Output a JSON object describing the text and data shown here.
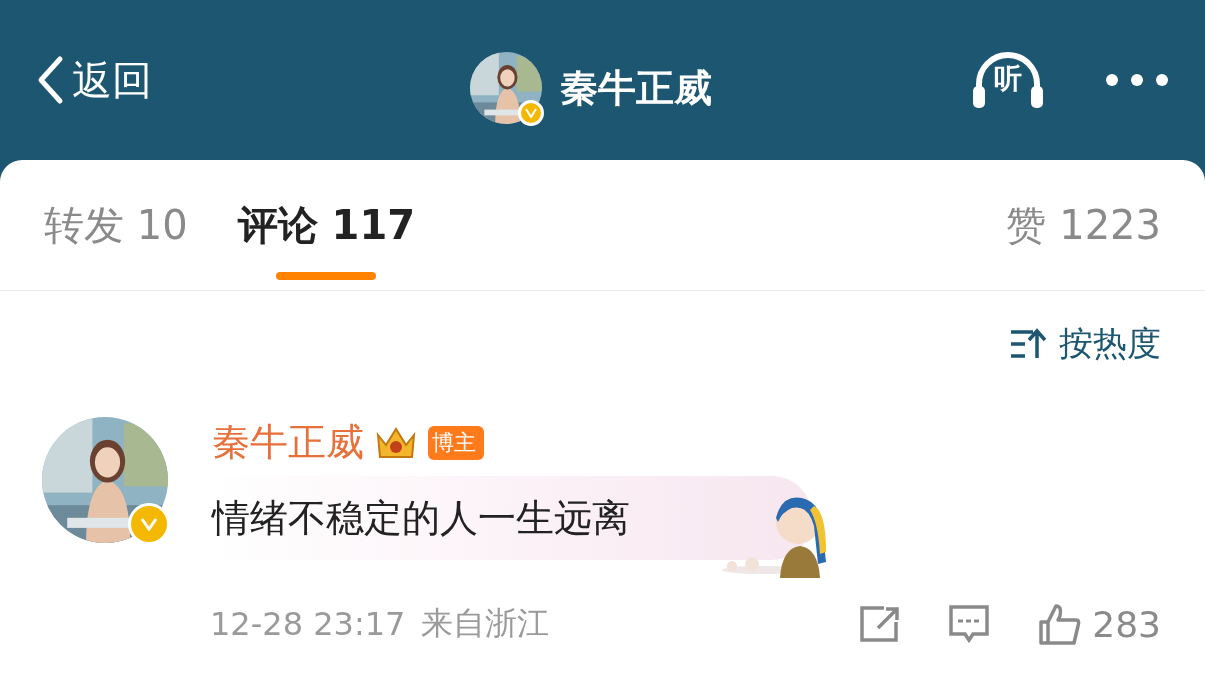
{
  "header": {
    "back_label": "返回",
    "title": "秦牛正威",
    "verified": true,
    "listen_label": "听"
  },
  "tabs": [
    {
      "label": "转发",
      "count": "10",
      "selected": false
    },
    {
      "label": "评论",
      "count": "117",
      "selected": true
    }
  ],
  "likes_tab": {
    "label": "赞",
    "count": "1223"
  },
  "sort": {
    "label": "按热度"
  },
  "comments": [
    {
      "name": "秦牛正威",
      "badge": "博主",
      "verified": true,
      "text": "情绪不稳定的人一生远离",
      "time": "12-28 23:17",
      "location": "来自浙江",
      "likes": "283"
    }
  ]
}
